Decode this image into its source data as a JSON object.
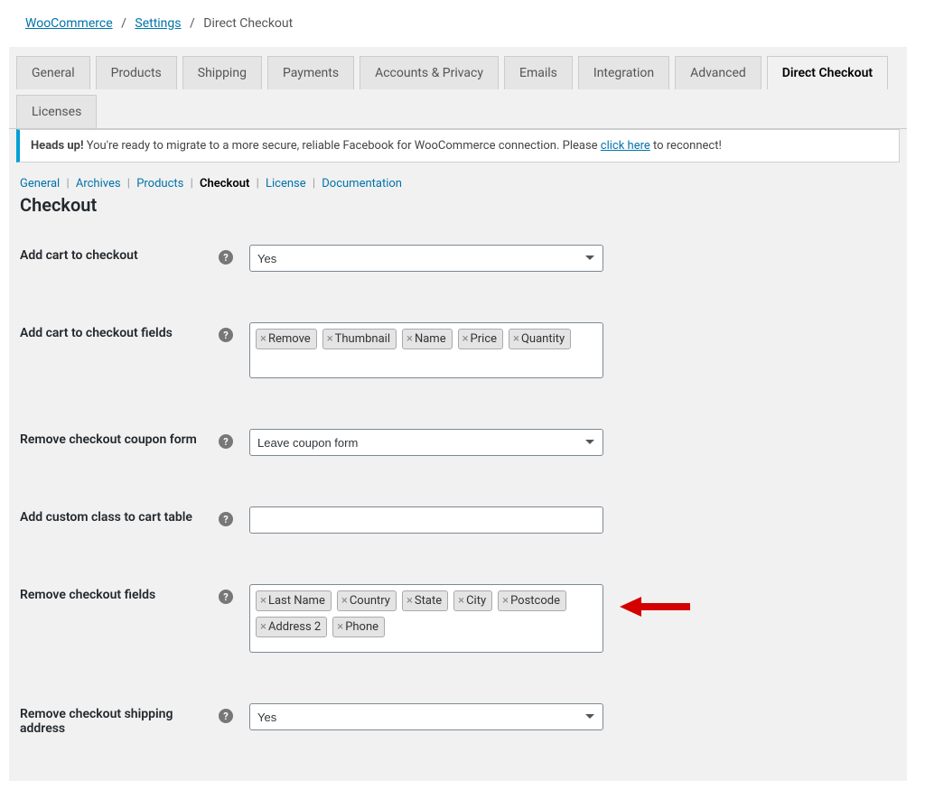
{
  "breadcrumb": {
    "woocommerce": "WooCommerce",
    "settings": "Settings",
    "current": "Direct Checkout"
  },
  "tabs": [
    "General",
    "Products",
    "Shipping",
    "Payments",
    "Accounts & Privacy",
    "Emails",
    "Integration",
    "Advanced",
    "Direct Checkout",
    "Licenses"
  ],
  "activeTab": "Direct Checkout",
  "notice": {
    "bold": "Heads up!",
    "text_before": " You're ready to migrate to a more secure, reliable Facebook for WooCommerce connection. Please ",
    "link": "click here",
    "text_after": " to reconnect!"
  },
  "subsections": [
    "General",
    "Archives",
    "Products",
    "Checkout",
    "License",
    "Documentation"
  ],
  "currentSubsection": "Checkout",
  "sectionTitle": "Checkout",
  "form": {
    "addCartCheckout": {
      "label": "Add cart to checkout",
      "value": "Yes"
    },
    "addCartFields": {
      "label": "Add cart to checkout fields",
      "chips": [
        "Remove",
        "Thumbnail",
        "Name",
        "Price",
        "Quantity"
      ]
    },
    "removeCoupon": {
      "label": "Remove checkout coupon form",
      "value": "Leave coupon form"
    },
    "customClass": {
      "label": "Add custom class to cart table",
      "value": ""
    },
    "removeFields": {
      "label": "Remove checkout fields",
      "chips": [
        "Last Name",
        "Country",
        "State",
        "City",
        "Postcode",
        "Address 2",
        "Phone"
      ]
    },
    "removeShipping": {
      "label": "Remove checkout shipping address",
      "value": "Yes"
    }
  }
}
